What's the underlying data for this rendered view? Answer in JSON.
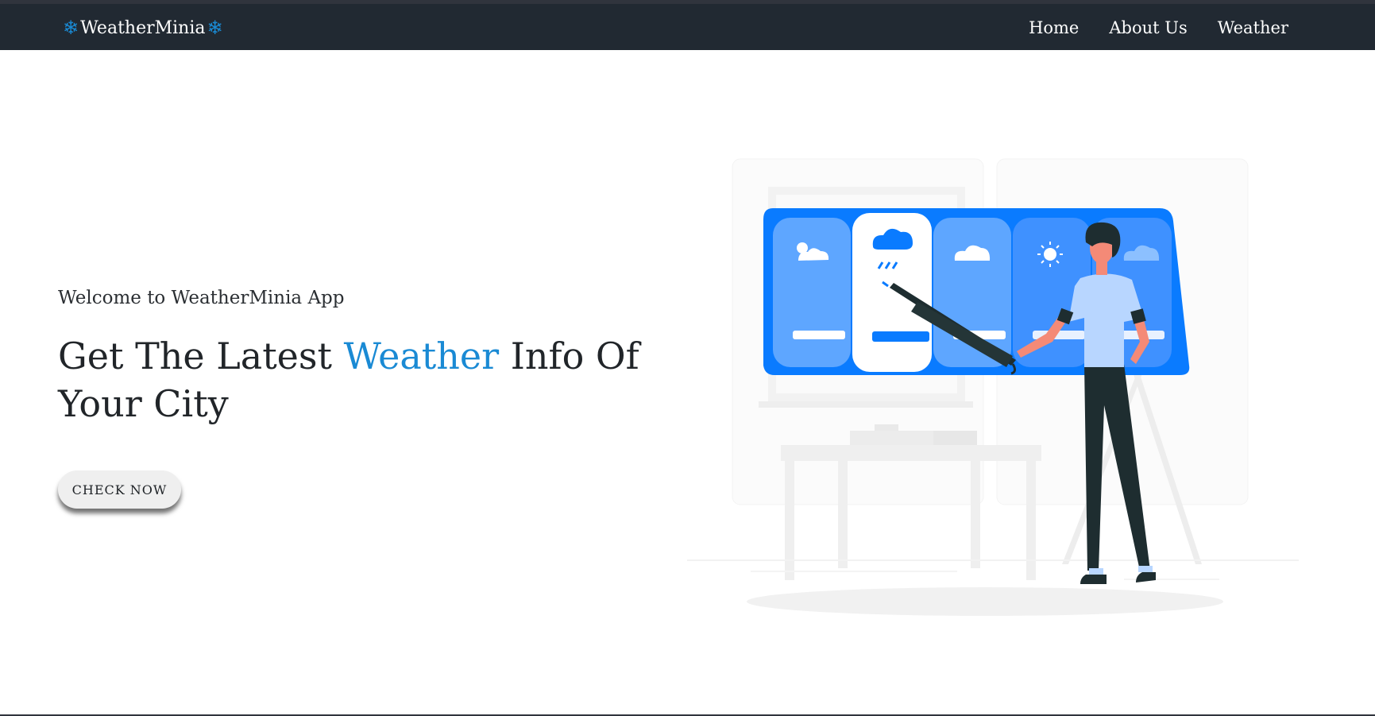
{
  "brand": {
    "name": "WeatherMinia",
    "icon": "snowflake-icon",
    "icon_glyph": "❄",
    "color": "#1a8ad4"
  },
  "nav": {
    "items": [
      {
        "label": "Home"
      },
      {
        "label": "About Us"
      },
      {
        "label": "Weather"
      }
    ]
  },
  "hero": {
    "welcome": "Welcome to WeatherMinia App",
    "headline_before": "Get The Latest ",
    "headline_accent": "Weather",
    "headline_after": " Info Of Your City",
    "cta_label": "CHECK NOW"
  },
  "colors": {
    "navbar_bg": "#212932",
    "accent": "#1a8ad4",
    "illustration_blue": "#0a7bff"
  }
}
